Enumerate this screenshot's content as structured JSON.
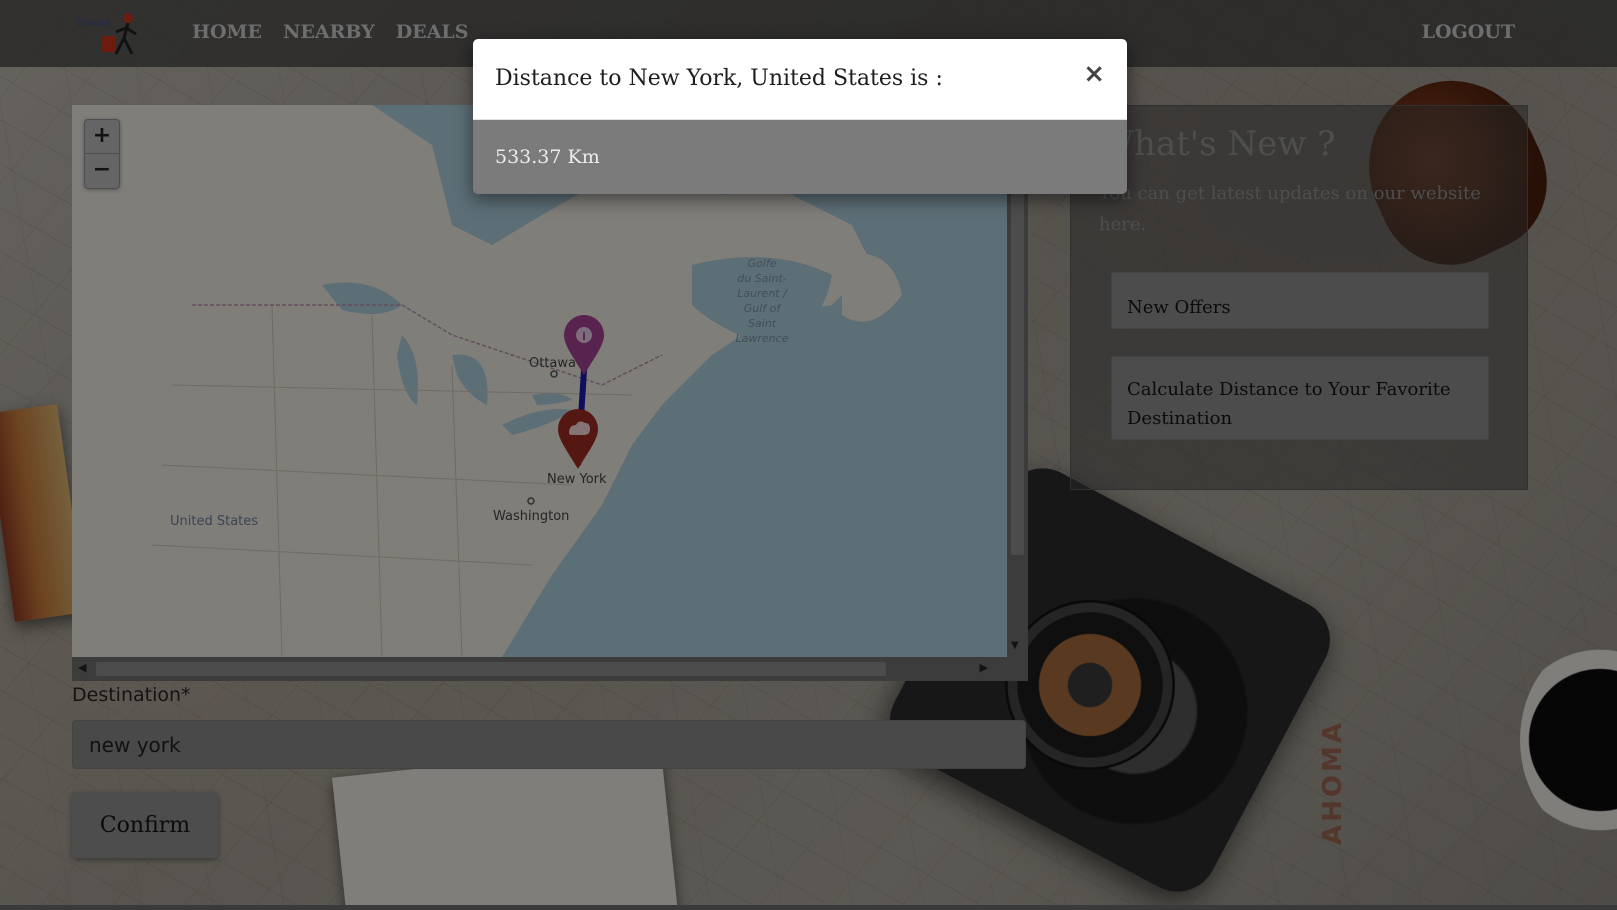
{
  "navbar": {
    "logo_text": "Trawell",
    "links": [
      {
        "label": "HOME"
      },
      {
        "label": "NEARBY"
      },
      {
        "label": "DEALS"
      }
    ],
    "logout_label": "LOGOUT"
  },
  "map": {
    "zoom_in_label": "+",
    "zoom_out_label": "−",
    "labels": {
      "ottawa": "Ottawa",
      "new_york": "New York",
      "washington": "Washington",
      "united_states": "United States",
      "gulf_line1": "Golfe",
      "gulf_line2": "du Saint-",
      "gulf_line3": "Laurent /",
      "gulf_line4": "Gulf of",
      "gulf_line5": "Saint",
      "gulf_line6": "Lawrence"
    },
    "colors": {
      "route": "#1a1aa8",
      "origin_marker": "#a0408f",
      "destination_marker": "#9b2a22"
    }
  },
  "form": {
    "destination_label": "Destination*",
    "destination_value": "new york",
    "confirm_label": "Confirm"
  },
  "news": {
    "title": "What's New ?",
    "subtitle": "You can get latest updates on our website here.",
    "buttons": [
      {
        "label": "New Offers"
      },
      {
        "label": "Calculate Distance to Your Favorite Destination"
      }
    ]
  },
  "modal": {
    "title": "Distance to New York, United States is :",
    "close_label": "×",
    "value": "533.37 Km"
  }
}
